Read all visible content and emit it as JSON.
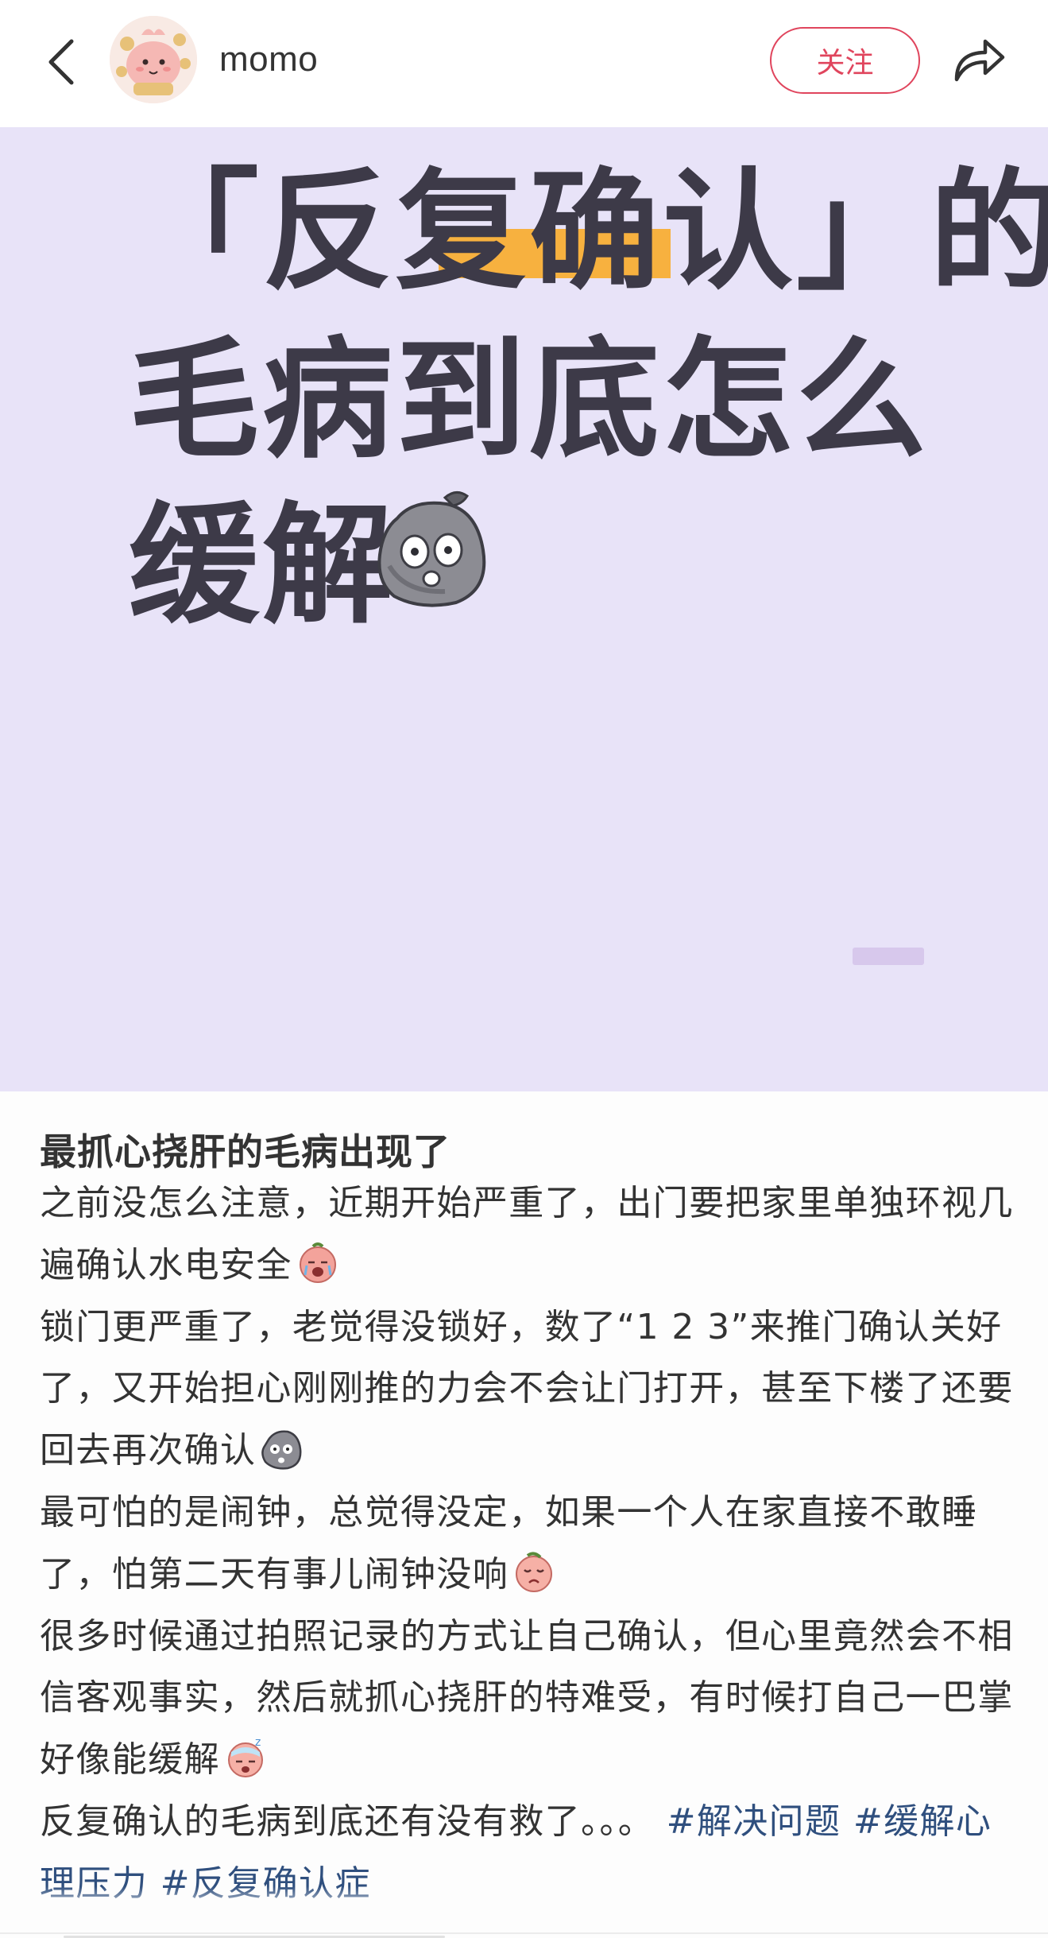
{
  "header": {
    "author_name": "momo",
    "follow_label": "关注",
    "icons": {
      "back": "chevron-left-icon",
      "share": "share-arrow-icon",
      "avatar": "cartoon-avatar"
    },
    "accent_color": "#e0455d"
  },
  "cover": {
    "background_color": "#e8e3f8",
    "highlight_color": "#f7b13f",
    "lines": [
      "「反复确认」的",
      "毛病到底怎么",
      "缓解"
    ],
    "emoji": "rock-face-emoji"
  },
  "post": {
    "title": "最抓心挠肝的毛病出现了",
    "paragraphs": [
      "之前没怎么注意，近期开始严重了，出门要把家里单独环视几遍确认水电安全",
      "锁门更严重了，老觉得没锁好，数了“1 2 3”来推门确认关好了，又开始担心刚刚推的力会不会让门打开，甚至下楼了还要回去再次确认",
      "最可怕的是闹钟，总觉得没定，如果一个人在家直接不敢睡了，怕第二天有事儿闹钟没响",
      "很多时候通过拍照记录的方式让自己确认，但心里竟然会不相信客观事实，然后就抓心挠肝的特难受，有时候打自己一巴掌好像能缓解",
      "反复确认的毛病到底还有没有救了。。。"
    ],
    "paragraph_emojis": [
      "crying-peach-emoji",
      "rock-face-emoji",
      "sad-peach-emoji",
      "sleepy-peach-emoji"
    ],
    "tags": [
      "#解决问题",
      "#缓解心理压力",
      "#反复确认症"
    ],
    "tag_color": "#2f4f7e"
  }
}
